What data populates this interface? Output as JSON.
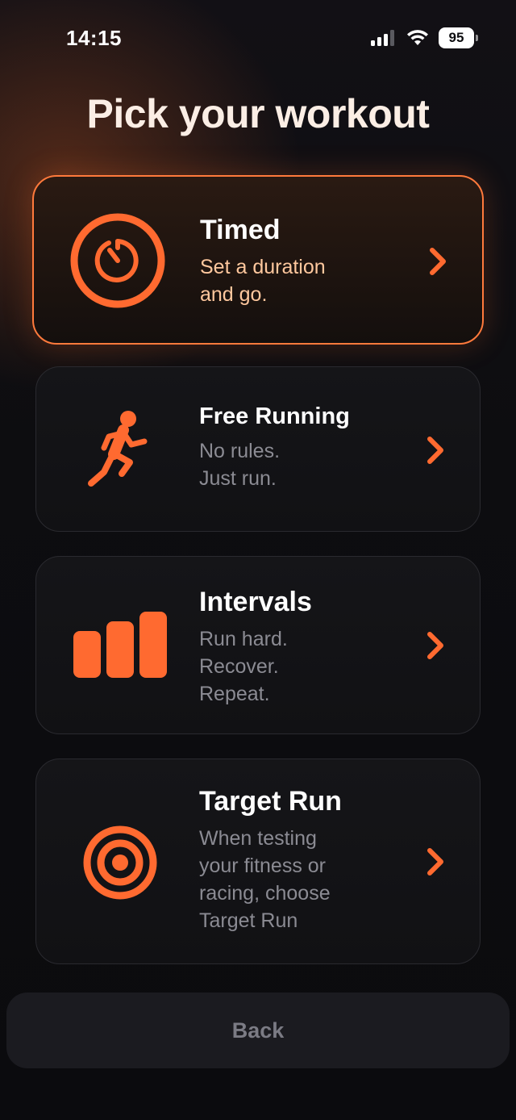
{
  "status_bar": {
    "time": "14:15",
    "battery_level": "95",
    "icons": [
      "signal-icon",
      "wifi-icon",
      "battery-icon"
    ]
  },
  "title": "Pick your workout",
  "workouts": [
    {
      "icon": "stopwatch-icon",
      "title": "Timed",
      "description_lines": [
        "Set a duration",
        "and go."
      ],
      "selected": true
    },
    {
      "icon": "runner-icon",
      "title": "Free Running",
      "description_lines": [
        "No rules.",
        "Just run."
      ],
      "selected": false
    },
    {
      "icon": "bars-icon",
      "title": "Intervals",
      "description_lines": [
        "Run hard.",
        "Recover.",
        "Repeat."
      ],
      "selected": false
    },
    {
      "icon": "target-icon",
      "title": "Target Run",
      "description_lines": [
        "When testing",
        "your fitness or",
        "racing, choose",
        "Target Run"
      ],
      "selected": false
    }
  ],
  "back_label": "Back",
  "colors": {
    "accent": "#ff6a30",
    "selected_border": "#ff7a3c",
    "selected_desc": "#ffc89e",
    "card_bg": "#131316",
    "muted_text": "#8b8b93",
    "background": "#0c0c0f"
  }
}
